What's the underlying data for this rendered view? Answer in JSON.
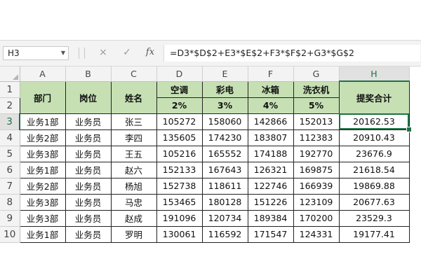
{
  "name_box": "H3",
  "formula_bar": {
    "cancel_icon": "×",
    "confirm_icon": "✓",
    "fx_label": "fx",
    "formula": "=D3*$D$2+E3*$E$2+F3*$F$2+G3*$G$2"
  },
  "columns": [
    "A",
    "B",
    "C",
    "D",
    "E",
    "F",
    "G",
    "H"
  ],
  "rows": [
    "1",
    "2",
    "3",
    "4",
    "5",
    "6",
    "7",
    "8",
    "9",
    "10"
  ],
  "selected_cell": "H3",
  "header": {
    "dept": "部门",
    "post": "岗位",
    "name": "姓名",
    "products": [
      "空调",
      "彩电",
      "冰箱",
      "洗衣机"
    ],
    "rates": [
      "2%",
      "3%",
      "4%",
      "5%"
    ],
    "bonus": "提奖合计"
  },
  "data_rows": [
    [
      "业务1部",
      "业务员",
      "张三",
      "105272",
      "158060",
      "142866",
      "152013",
      "20162.53"
    ],
    [
      "业务2部",
      "业务员",
      "李四",
      "135605",
      "174230",
      "183807",
      "112383",
      "20910.43"
    ],
    [
      "业务3部",
      "业务员",
      "王五",
      "105216",
      "165552",
      "174188",
      "192770",
      "23676.9"
    ],
    [
      "业务1部",
      "业务员",
      "赵六",
      "152133",
      "167643",
      "126321",
      "169875",
      "21618.54"
    ],
    [
      "业务2部",
      "业务员",
      "杨旭",
      "152738",
      "118611",
      "122746",
      "166939",
      "19869.88"
    ],
    [
      "业务3部",
      "业务员",
      "马忠",
      "153465",
      "180128",
      "151226",
      "123109",
      "20677.63"
    ],
    [
      "业务3部",
      "业务员",
      "赵成",
      "191096",
      "120734",
      "189384",
      "170200",
      "23529.3"
    ],
    [
      "业务1部",
      "业务员",
      "罗明",
      "130061",
      "116592",
      "171547",
      "124331",
      "19177.41"
    ]
  ],
  "colors": {
    "header_fill": "#c6e0b4",
    "selection": "#1e7145"
  }
}
